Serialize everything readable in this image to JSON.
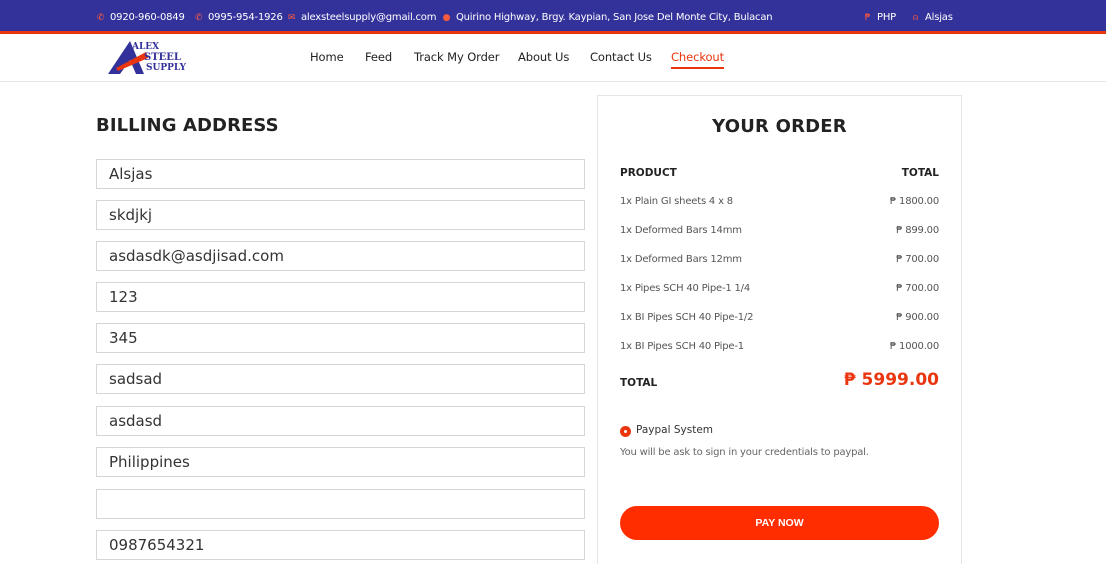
{
  "topbar": {
    "phone1": "0920-960-0849",
    "phone2": "0995-954-1926",
    "email": "alexsteelsupply@gmail.com",
    "address": "Quirino Highway, Brgy. Kaypian, San Jose Del Monte City, Bulacan",
    "currency": "PHP",
    "user": "Alsjas"
  },
  "logo": {
    "line1": "ALEX",
    "line2": "STEEL",
    "line3": "SUPPLY"
  },
  "nav": {
    "items": [
      "Home",
      "Feed",
      "Track My Order",
      "About Us",
      "Contact Us",
      "Checkout"
    ],
    "active": "Checkout"
  },
  "billing": {
    "title": "BILLING ADDRESS",
    "fields": [
      "Alsjas",
      "skdjkj",
      "asdasdk@asdjisad.com",
      "123",
      "345",
      "sadsad",
      "asdasd",
      "Philippines",
      "",
      "0987654321"
    ]
  },
  "order": {
    "title": "YOUR ORDER",
    "product_header": "PRODUCT",
    "total_header": "TOTAL",
    "items": [
      {
        "name": "1x Plain GI sheets 4 x 8",
        "price": "₱ 1800.00"
      },
      {
        "name": "1x Deformed Bars 14mm",
        "price": "₱ 899.00"
      },
      {
        "name": "1x Deformed Bars 12mm",
        "price": "₱ 700.00"
      },
      {
        "name": "1x Pipes SCH 40 Pipe-1 1/4",
        "price": "₱ 700.00"
      },
      {
        "name": "1x BI Pipes SCH 40 Pipe-1/2",
        "price": "₱ 900.00"
      },
      {
        "name": "1x BI Pipes SCH 40 Pipe-1",
        "price": "₱ 1000.00"
      }
    ],
    "total_label": "TOTAL",
    "total_value": "₱ 5999.00",
    "payment_method": "Paypal System",
    "payment_desc": "You will be ask to sign in your credentials to paypal.",
    "pay_button": "PAY NOW"
  },
  "colors": {
    "topbar": "#33329b",
    "accent": "#e9360f",
    "button": "#ff2d00"
  }
}
